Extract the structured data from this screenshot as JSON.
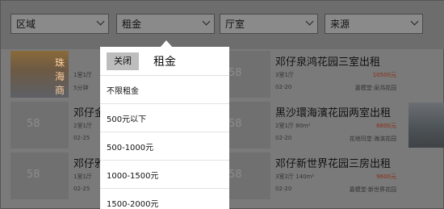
{
  "filters": {
    "district": "区域",
    "rent": "租金",
    "rooms": "厅室",
    "source": "来源"
  },
  "listings": [
    {
      "title": "珠海商",
      "spec": "1室1厅",
      "date": "5分钟",
      "price": "",
      "location": "",
      "watermark": "58"
    },
    {
      "title": "邓仔金",
      "spec": "2室1厅",
      "date": "02-25",
      "price": "",
      "location": "",
      "watermark": "58"
    },
    {
      "title": "邓仔雅",
      "spec": "1室1厅",
      "date": "02-25",
      "price": "",
      "location": "",
      "watermark": "58"
    },
    {
      "title": "邓仔泉鸿花园三室出租",
      "spec": "3室1厅",
      "date": "02-20",
      "price": "10500元",
      "location": "嘉模堂·泉鸿花园",
      "watermark": "58"
    },
    {
      "title": "黑沙環海濱花园两室出租",
      "spec": "2室1厅 80m²",
      "date": "02-20",
      "price": "8800元",
      "location": "花地玛堂·海滨花园",
      "watermark": "58"
    },
    {
      "title": "邓仔新世界花园三房出租",
      "spec": "3室2厅 140m²",
      "date": "02-20",
      "price": "9600元",
      "location": "嘉模堂·新世界花园",
      "watermark": "58"
    }
  ],
  "popover": {
    "close_label": "关闭",
    "title": "租金",
    "options": [
      "不限租金",
      "500元以下",
      "500-1000元",
      "1000-1500元",
      "1500-2000元"
    ]
  }
}
